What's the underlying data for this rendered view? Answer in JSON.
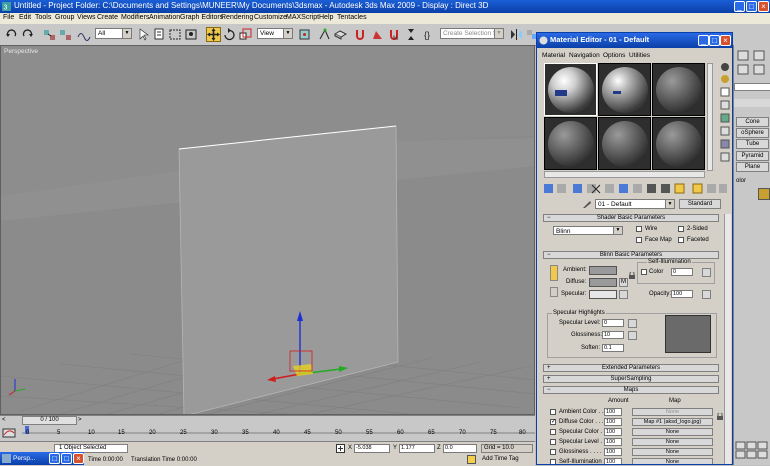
{
  "window": {
    "title": "Untitled    - Project Folder: C:\\Documents and Settings\\MUNEER\\My Documents\\3dsmax    - Autodesk 3ds Max  2009          - Display : Direct 3D"
  },
  "menu": [
    "File",
    "Edit",
    "Tools",
    "Group",
    "Views",
    "Create",
    "Modifiers",
    "Animation",
    "Graph Editors",
    "Rendering",
    "Customize",
    "MAXScript",
    "Help",
    "Tentacles"
  ],
  "toolbar": {
    "selection_filter": "All",
    "ref_coord": "View",
    "named_selection_placeholder": "Create Selection Set"
  },
  "viewport": {
    "label": "Perspective"
  },
  "timeline": {
    "frame_display": "0 / 100",
    "ticks": [
      "0",
      "5",
      "10",
      "15",
      "20",
      "25",
      "30",
      "35",
      "40",
      "45",
      "50",
      "55",
      "60",
      "65",
      "70",
      "75",
      "80"
    ]
  },
  "status": {
    "selection": "1 Object Selected",
    "x_label": "X",
    "x": "-5.038",
    "y_label": "Y",
    "y": "1.177",
    "z_label": "Z",
    "z": "0.0",
    "grid": "Grid = 10.0",
    "time_label": "Time  0:00:00",
    "translation_time": "Translation Time  0:00:00",
    "add_time_tag": "Add Time Tag"
  },
  "minimized_window": {
    "label": "Persp..."
  },
  "command_panel": {
    "buttons": [
      "Cone",
      "oSphere",
      "Tube",
      "Pyramid",
      "Plane"
    ],
    "color_label": "olor"
  },
  "material_editor": {
    "title": "Material Editor - 01 - Default",
    "menu": [
      "Material",
      "Navigation",
      "Options",
      "Utilities"
    ],
    "material_name": "01 - Default",
    "material_type": "Standard",
    "shader_rollout": "Shader Basic Parameters",
    "shader": "Blinn",
    "shader_checks": [
      {
        "label": "Wire",
        "checked": false
      },
      {
        "label": "2-Sided",
        "checked": false
      },
      {
        "label": "Face Map",
        "checked": false
      },
      {
        "label": "Faceted",
        "checked": false
      }
    ],
    "blinn_rollout": "Blinn Basic Parameters",
    "self_illum_title": "Self-Illumination",
    "ambient_label": "Ambient:",
    "diffuse_label": "Diffuse:",
    "specular_label": "Specular:",
    "diffuse_map_marker": "M",
    "color_label": "Color",
    "color_value": "0",
    "opacity_label": "Opacity:",
    "opacity_value": "100",
    "spec_highlights_title": "Specular Highlights",
    "specular_level_label": "Specular Level:",
    "specular_level": "0",
    "glossiness_label": "Glossiness:",
    "glossiness": "10",
    "soften_label": "Soften:",
    "soften": "0.1",
    "extended_rollout": "Extended Parameters",
    "supersampling_rollout": "SuperSampling",
    "maps_rollout": "Maps",
    "maps_amount_header": "Amount",
    "maps_map_header": "Map",
    "maps": [
      {
        "label": "Ambient Color . . .",
        "amount": "100",
        "map": "None",
        "checked": false,
        "disabled": true
      },
      {
        "label": "Diffuse Color . . .",
        "amount": "100",
        "map": "Map #1 (aksd_logo.jpg)",
        "checked": true,
        "disabled": false
      },
      {
        "label": "Specular Color . . .",
        "amount": "100",
        "map": "None",
        "checked": false,
        "disabled": false
      },
      {
        "label": "Specular Level . .",
        "amount": "100",
        "map": "None",
        "checked": false,
        "disabled": false
      },
      {
        "label": "Glossiness . . . . . .",
        "amount": "100",
        "map": "None",
        "checked": false,
        "disabled": false
      },
      {
        "label": "Self-Illumination . .",
        "amount": "100",
        "map": "None",
        "checked": false,
        "disabled": false
      }
    ]
  }
}
